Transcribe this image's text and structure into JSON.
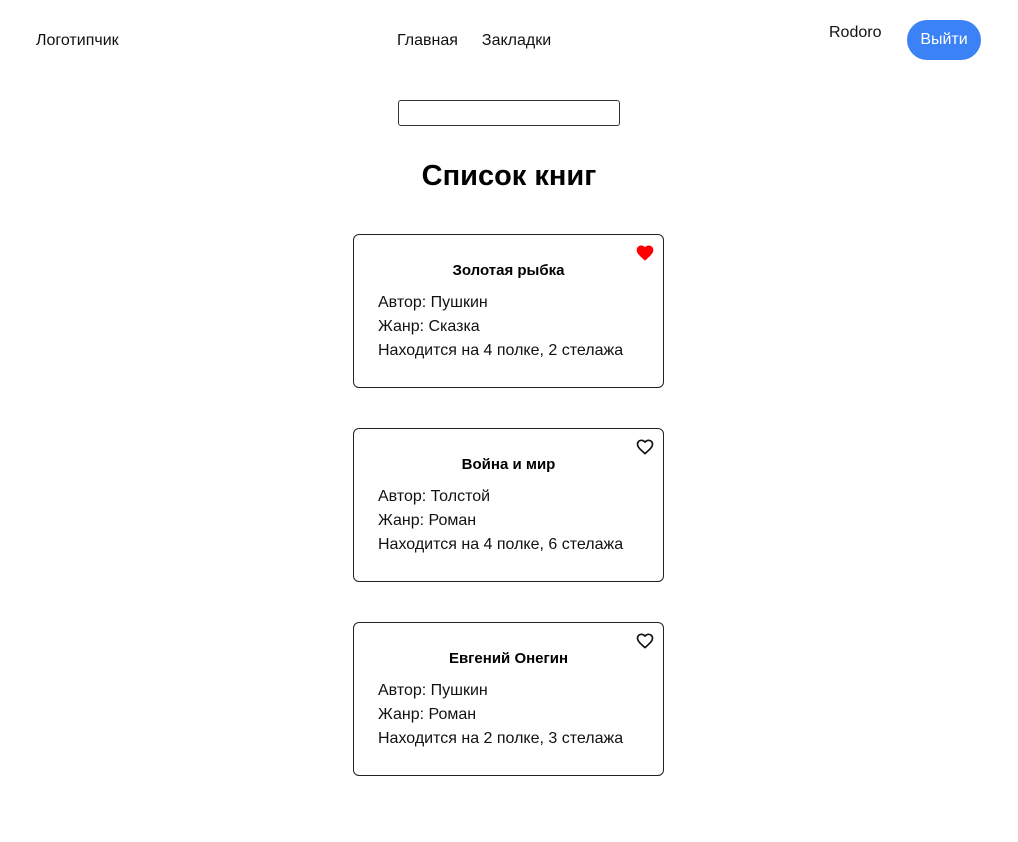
{
  "header": {
    "logo": "Логотипчик",
    "nav": [
      {
        "label": "Главная"
      },
      {
        "label": "Закладки"
      }
    ],
    "username": "Rodoro",
    "logout_label": "Выйти"
  },
  "search": {
    "value": "",
    "placeholder": ""
  },
  "main": {
    "title": "Список книг"
  },
  "books": [
    {
      "title": "Золотая рыбка",
      "author": "Автор: Пушкин",
      "genre": "Жанр: Сказка",
      "location": "Находится на 4 полке, 2 стелажа",
      "bookmarked": true,
      "icon": "heart-filled-icon"
    },
    {
      "title": "Война и мир",
      "author": "Автор: Толстой",
      "genre": "Жанр: Роман",
      "location": "Находится на 4 полке, 6 стелажа",
      "bookmarked": false,
      "icon": "heart-outline-icon"
    },
    {
      "title": "Евгений Онегин",
      "author": "Автор: Пушкин",
      "genre": "Жанр: Роман",
      "location": "Находится на 2 полке, 3 стелажа",
      "bookmarked": false,
      "icon": "heart-outline-icon"
    }
  ],
  "colors": {
    "accent": "#3b82f6",
    "bookmark_active": "#ff0000",
    "text": "#111111"
  }
}
